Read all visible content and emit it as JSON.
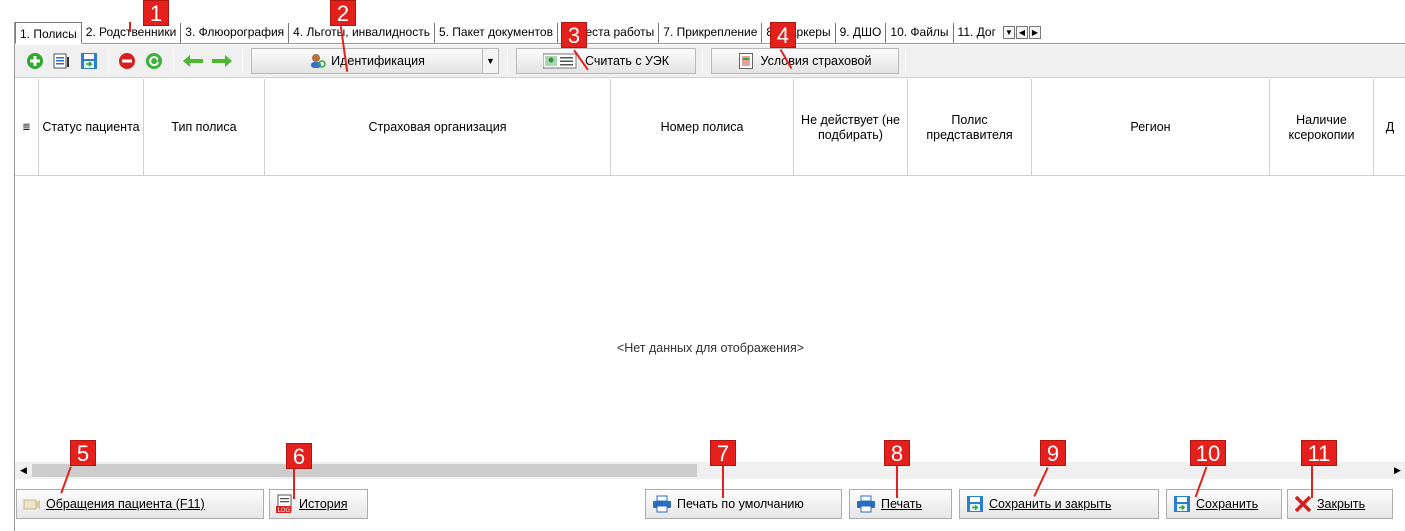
{
  "tabs": [
    {
      "label": "1. Полисы",
      "active": true
    },
    {
      "label": "2. Родственники"
    },
    {
      "label": "3. Флюорография"
    },
    {
      "label": "4. Льготы, инвалидность"
    },
    {
      "label": "5. Пакет документов"
    },
    {
      "label": "6. Места работы"
    },
    {
      "label": "7. Прикрепление"
    },
    {
      "label": "8. Маркеры"
    },
    {
      "label": "9. ДШО"
    },
    {
      "label": "10. Файлы"
    },
    {
      "label": "11. Дог"
    }
  ],
  "toolbar": {
    "identification_label": "Идентификация",
    "read_uek_label": "Считать с УЭК",
    "insurance_terms_label": "Условия страховой"
  },
  "grid": {
    "columns": [
      "Статус пациента",
      "Тип полиса",
      "Страховая организация",
      "Номер полиса",
      "Не действует (не подбирать)",
      "Полис представителя",
      "Регион",
      "Наличие ксерокопии",
      "Д"
    ],
    "empty_text": "<Нет данных для отображения>"
  },
  "bottom": {
    "appeals_label": "Обращения пациента (F11)",
    "history_label": "История",
    "print_default_label": "Печать по умолчанию",
    "print_label": "Печать",
    "save_close_label": "Сохранить и закрыть",
    "save_label": "Сохранить",
    "close_label": "Закрыть"
  },
  "markers": [
    "1",
    "2",
    "3",
    "4",
    "5",
    "6",
    "7",
    "8",
    "9",
    "10",
    "11"
  ],
  "colors": {
    "marker": "#e3201b",
    "add": "#2fa82f",
    "delete": "#d62020",
    "arrow": "#2fa82f"
  }
}
